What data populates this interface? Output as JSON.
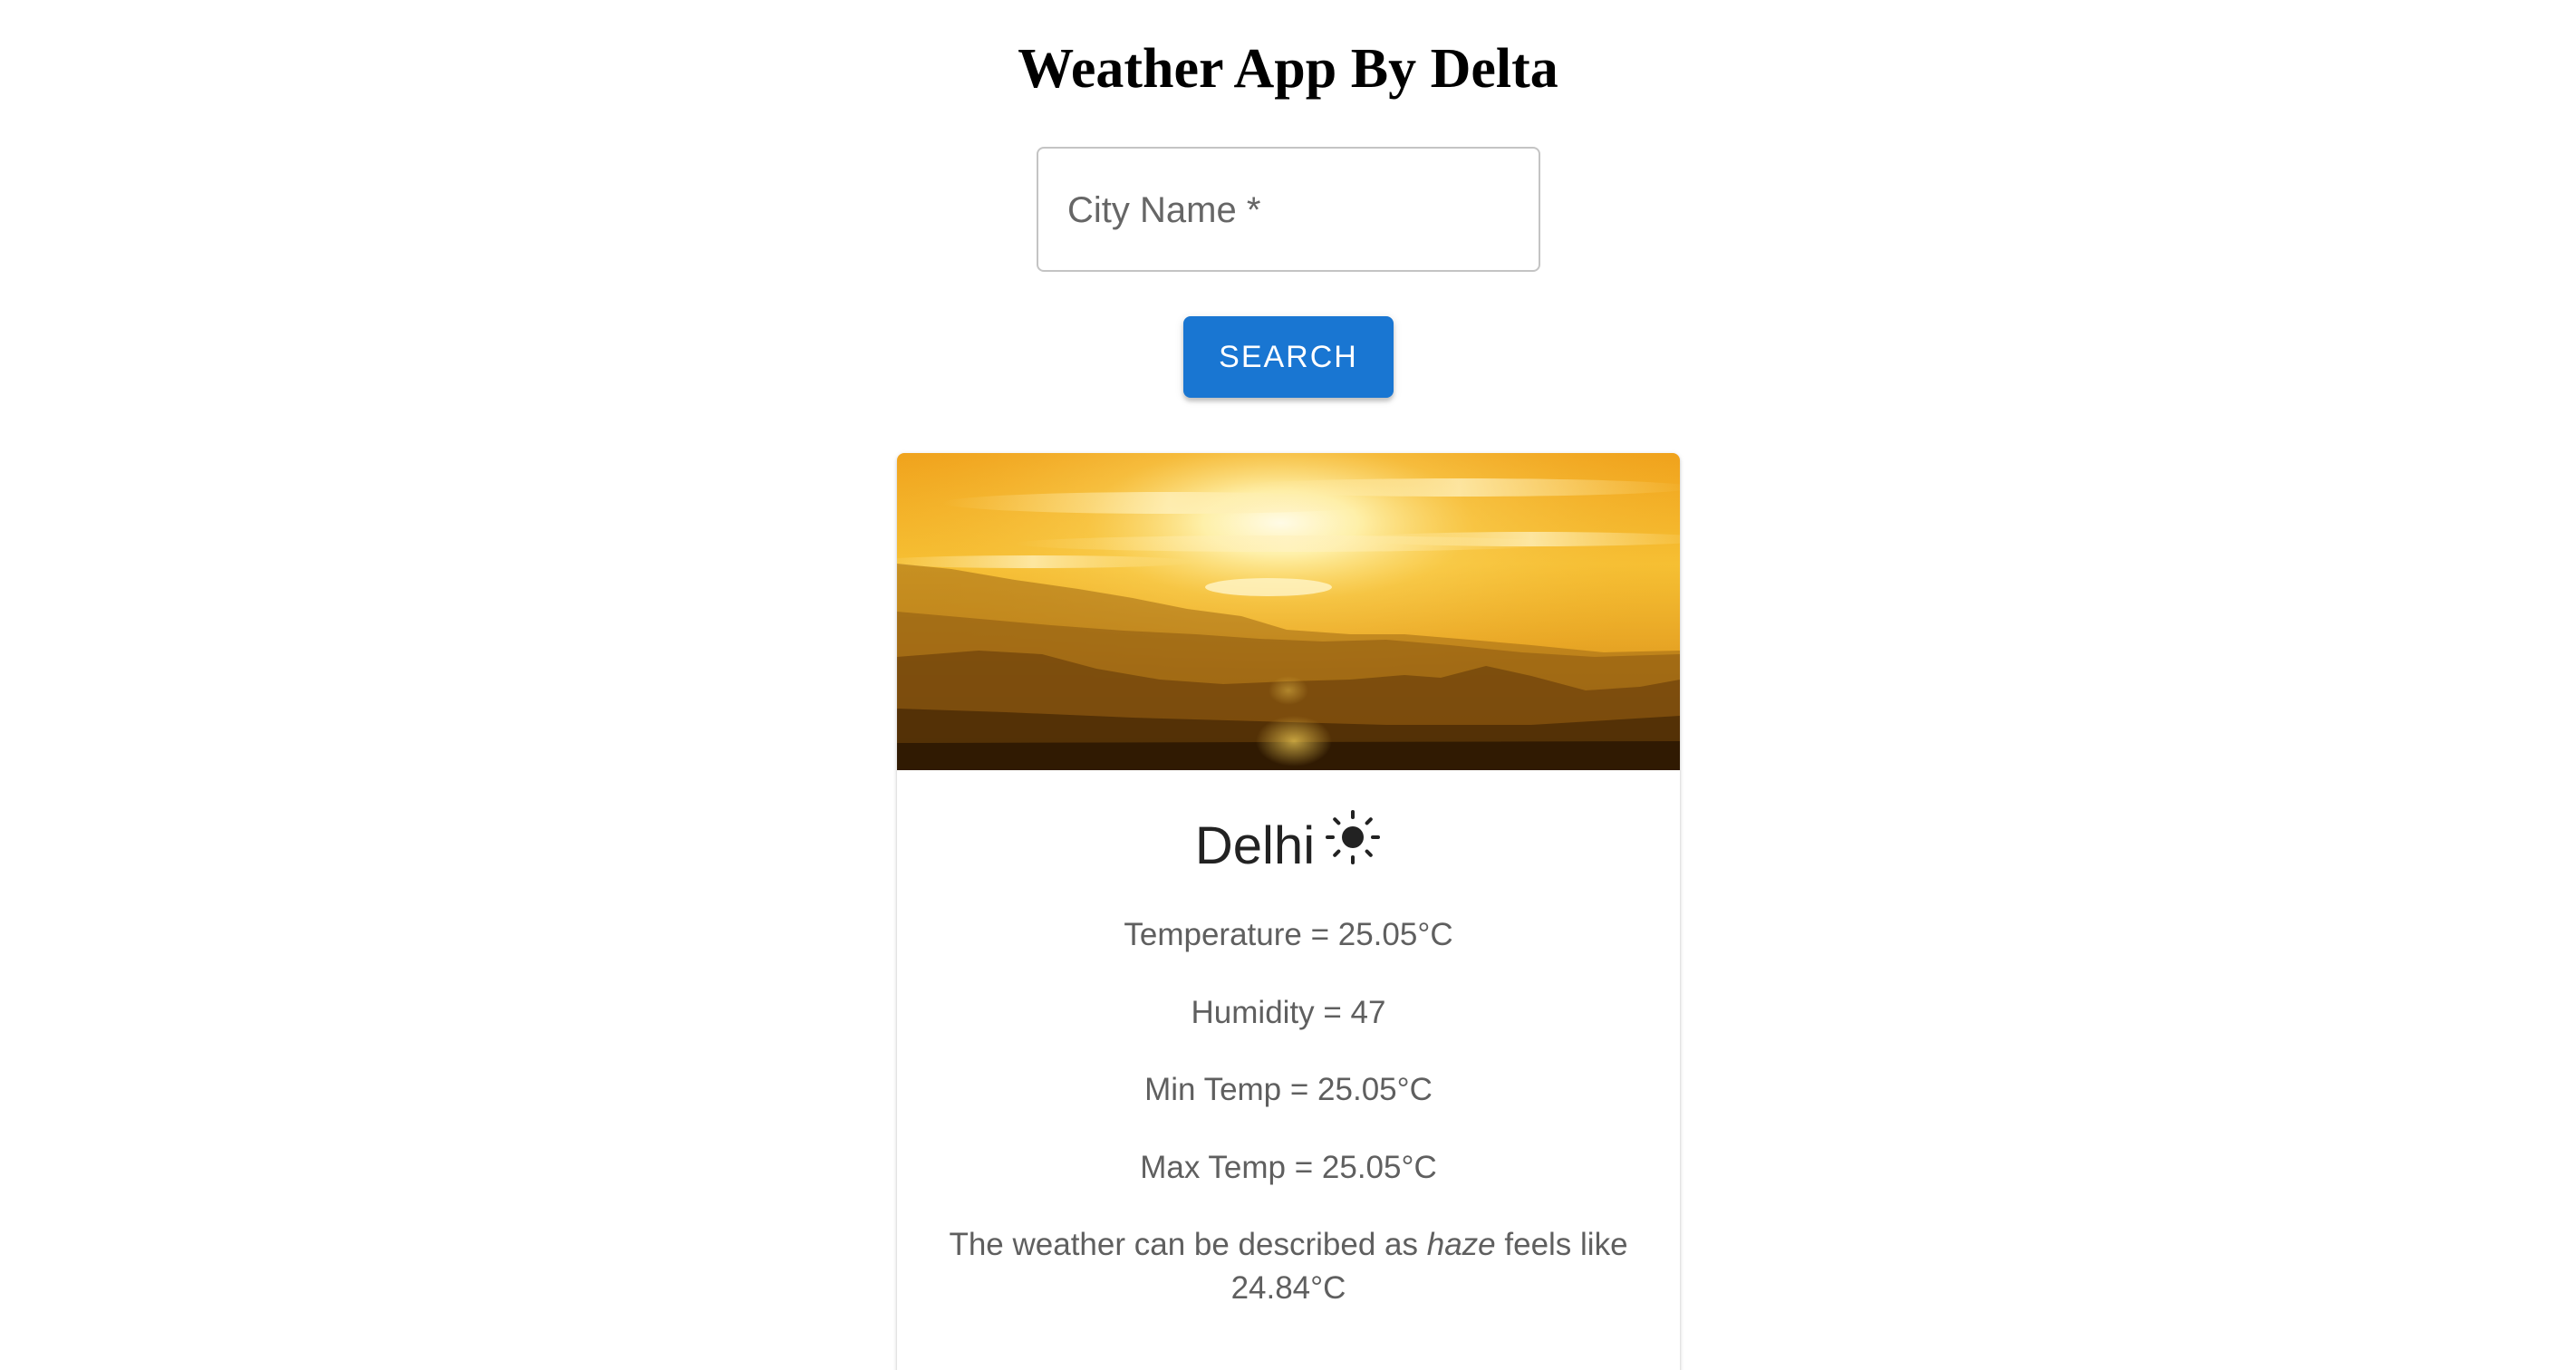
{
  "header": {
    "title": "Weather App By Delta"
  },
  "search": {
    "label": "City Name *",
    "value": "",
    "button_label": "SEARCH"
  },
  "card": {
    "city": "Delhi",
    "weather_icon": "sunny-icon",
    "temperature_text": "Temperature = 25.05°C",
    "humidity_text": "Humidity = 47",
    "min_temp_text": "Min Temp = 25.05°C",
    "max_temp_text": "Max Temp = 25.05°C",
    "description_prefix": "The weather can be described as",
    "description_value": "haze",
    "description_suffix": "feels like 24.84°C"
  },
  "colors": {
    "accent": "#1976d2",
    "title": "#000000",
    "body_text": "#5f5f5f",
    "city_text": "#222222",
    "field_border": "#c4c4c4"
  }
}
